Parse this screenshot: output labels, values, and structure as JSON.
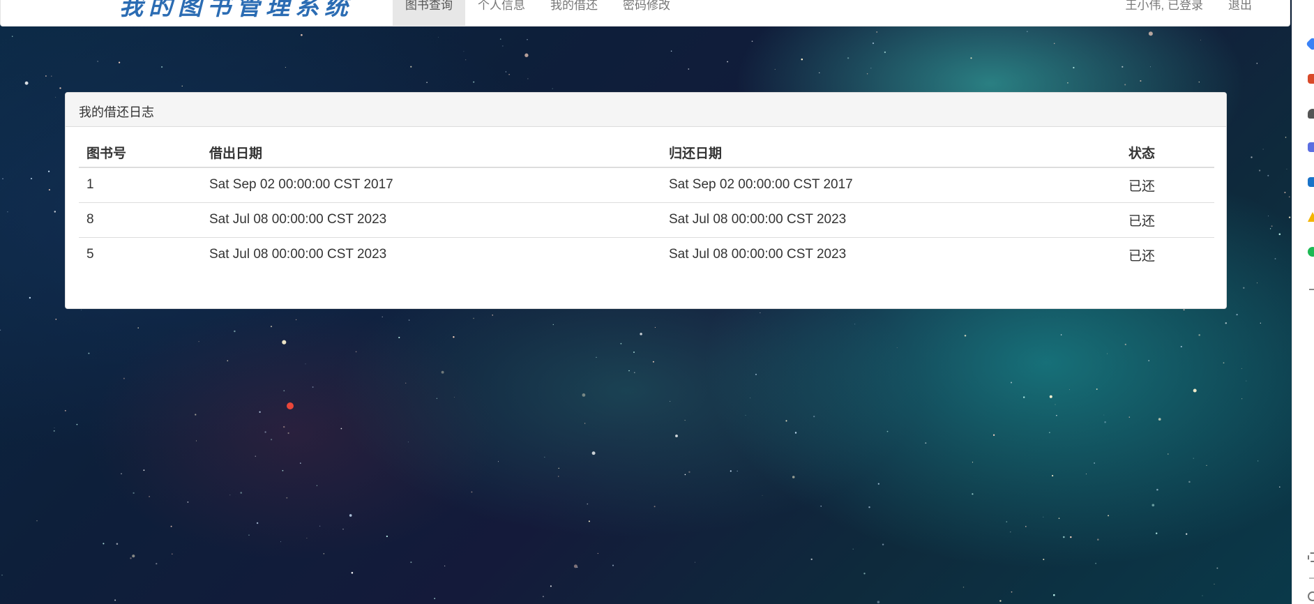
{
  "header": {
    "brand": "我的图书管理系统",
    "tabs": [
      {
        "label": "图书查询",
        "active": true
      },
      {
        "label": "个人信息",
        "active": false
      },
      {
        "label": "我的借还",
        "active": false
      },
      {
        "label": "密码修改",
        "active": false
      }
    ],
    "user_status": "王小伟, 已登录",
    "logout_label": "退出"
  },
  "panel": {
    "title": "我的借还日志",
    "columns": [
      "图书号",
      "借出日期",
      "归还日期",
      "状态"
    ],
    "rows": [
      [
        "1",
        "Sat Sep 02 00:00:00 CST 2017",
        "Sat Sep 02 00:00:00 CST 2017",
        "已还"
      ],
      [
        "8",
        "Sat Jul 08 00:00:00 CST 2023",
        "Sat Jul 08 00:00:00 CST 2023",
        "已还"
      ],
      [
        "5",
        "Sat Jul 08 00:00:00 CST 2023",
        "Sat Jul 08 00:00:00 CST 2023",
        "已还"
      ]
    ]
  },
  "sidebar": {
    "icons": [
      {
        "name": "diamond-icon",
        "color": "#3b82f6"
      },
      {
        "name": "gift-icon",
        "color": "#d94a2a"
      },
      {
        "name": "person-icon",
        "color": "#555555"
      },
      {
        "name": "copilot-icon",
        "color": "#5b6ee1"
      },
      {
        "name": "outlook-icon",
        "color": "#1a73c8"
      },
      {
        "name": "drive-icon",
        "color": "#f4b400"
      },
      {
        "name": "spotify-icon",
        "color": "#1db954"
      }
    ]
  },
  "colors": {
    "brand": "#2b6cb3",
    "active_tab_bg": "#e7e7e7",
    "panel_heading_bg": "#f5f5f5"
  }
}
